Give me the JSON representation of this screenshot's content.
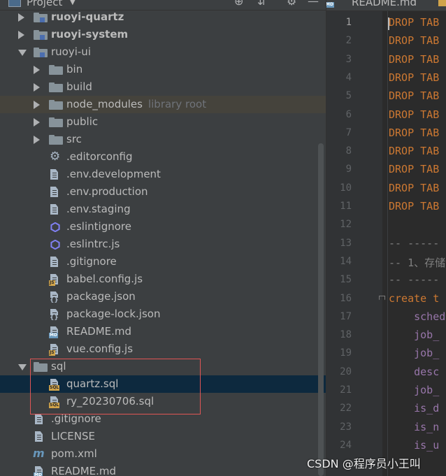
{
  "panel": {
    "title": "Project"
  },
  "tree": [
    {
      "label": "ruoyi-quartz",
      "kind": "module",
      "bold": true,
      "arrow": "r"
    },
    {
      "label": "ruoyi-system",
      "kind": "module",
      "bold": true,
      "arrow": "r"
    },
    {
      "label": "ruoyi-ui",
      "kind": "module",
      "bold": false,
      "arrow": "d"
    },
    {
      "label": "bin",
      "kind": "folder",
      "arrow": "r"
    },
    {
      "label": "build",
      "kind": "folder",
      "arrow": "r"
    },
    {
      "label": "node_modules",
      "kind": "folder",
      "arrow": "r",
      "hint": "library root",
      "highlight": true
    },
    {
      "label": "public",
      "kind": "folder",
      "arrow": "r"
    },
    {
      "label": "src",
      "kind": "folder",
      "arrow": "r"
    },
    {
      "label": ".editorconfig",
      "kind": "gear"
    },
    {
      "label": ".env.development",
      "kind": "file"
    },
    {
      "label": ".env.production",
      "kind": "file"
    },
    {
      "label": ".env.staging",
      "kind": "file"
    },
    {
      "label": ".eslintignore",
      "kind": "eslint"
    },
    {
      "label": ".eslintrc.js",
      "kind": "eslint"
    },
    {
      "label": ".gitignore",
      "kind": "file"
    },
    {
      "label": "babel.config.js",
      "kind": "js"
    },
    {
      "label": "package.json",
      "kind": "json"
    },
    {
      "label": "package-lock.json",
      "kind": "json"
    },
    {
      "label": "README.md",
      "kind": "md"
    },
    {
      "label": "vue.config.js",
      "kind": "js"
    },
    {
      "label": "sql",
      "kind": "folder",
      "arrow": "d"
    },
    {
      "label": "quartz.sql",
      "kind": "sql",
      "selected": true
    },
    {
      "label": "ry_20230706.sql",
      "kind": "sql"
    },
    {
      "label": ".gitignore",
      "kind": "file"
    },
    {
      "label": "LICENSE",
      "kind": "file"
    },
    {
      "label": "pom.xml",
      "kind": "maven"
    },
    {
      "label": "README.md",
      "kind": "md"
    }
  ],
  "editor": {
    "tab_label": "README.md",
    "lines": [
      {
        "n": "1",
        "tokens": [
          [
            "kw",
            "DROP TAB"
          ]
        ]
      },
      {
        "n": "2",
        "tokens": [
          [
            "kw",
            "DROP TAB"
          ]
        ]
      },
      {
        "n": "3",
        "tokens": [
          [
            "kw",
            "DROP TAB"
          ]
        ]
      },
      {
        "n": "4",
        "tokens": [
          [
            "kw",
            "DROP TAB"
          ]
        ]
      },
      {
        "n": "5",
        "tokens": [
          [
            "kw",
            "DROP TAB"
          ]
        ]
      },
      {
        "n": "6",
        "tokens": [
          [
            "kw",
            "DROP TAB"
          ]
        ]
      },
      {
        "n": "7",
        "tokens": [
          [
            "kw",
            "DROP TAB"
          ]
        ]
      },
      {
        "n": "8",
        "tokens": [
          [
            "kw",
            "DROP TAB"
          ]
        ]
      },
      {
        "n": "9",
        "tokens": [
          [
            "kw",
            "DROP TAB"
          ]
        ]
      },
      {
        "n": "10",
        "tokens": [
          [
            "kw",
            "DROP TAB"
          ]
        ]
      },
      {
        "n": "11",
        "tokens": [
          [
            "kw",
            "DROP TAB"
          ]
        ]
      },
      {
        "n": "12",
        "tokens": []
      },
      {
        "n": "13",
        "tokens": [
          [
            "cm",
            "-- -----"
          ]
        ]
      },
      {
        "n": "14",
        "tokens": [
          [
            "cm",
            "-- 1、存储"
          ]
        ]
      },
      {
        "n": "15",
        "tokens": [
          [
            "cm",
            "-- -----"
          ]
        ]
      },
      {
        "n": "16",
        "tokens": [
          [
            "kw",
            "create t"
          ]
        ],
        "fold": true
      },
      {
        "n": "17",
        "tokens": [
          [
            "fld",
            "    sched"
          ]
        ]
      },
      {
        "n": "18",
        "tokens": [
          [
            "fld",
            "    job_"
          ]
        ]
      },
      {
        "n": "19",
        "tokens": [
          [
            "fld",
            "    job_"
          ]
        ]
      },
      {
        "n": "20",
        "tokens": [
          [
            "fld",
            "    desc"
          ]
        ]
      },
      {
        "n": "21",
        "tokens": [
          [
            "fld",
            "    job_"
          ]
        ]
      },
      {
        "n": "22",
        "tokens": [
          [
            "fld",
            "    is_d"
          ]
        ]
      },
      {
        "n": "23",
        "tokens": [
          [
            "fld",
            "    is_n"
          ]
        ]
      },
      {
        "n": "24",
        "tokens": [
          [
            "fld",
            "    is_u"
          ]
        ]
      }
    ]
  },
  "watermark": "CSDN @程序员小王叫"
}
